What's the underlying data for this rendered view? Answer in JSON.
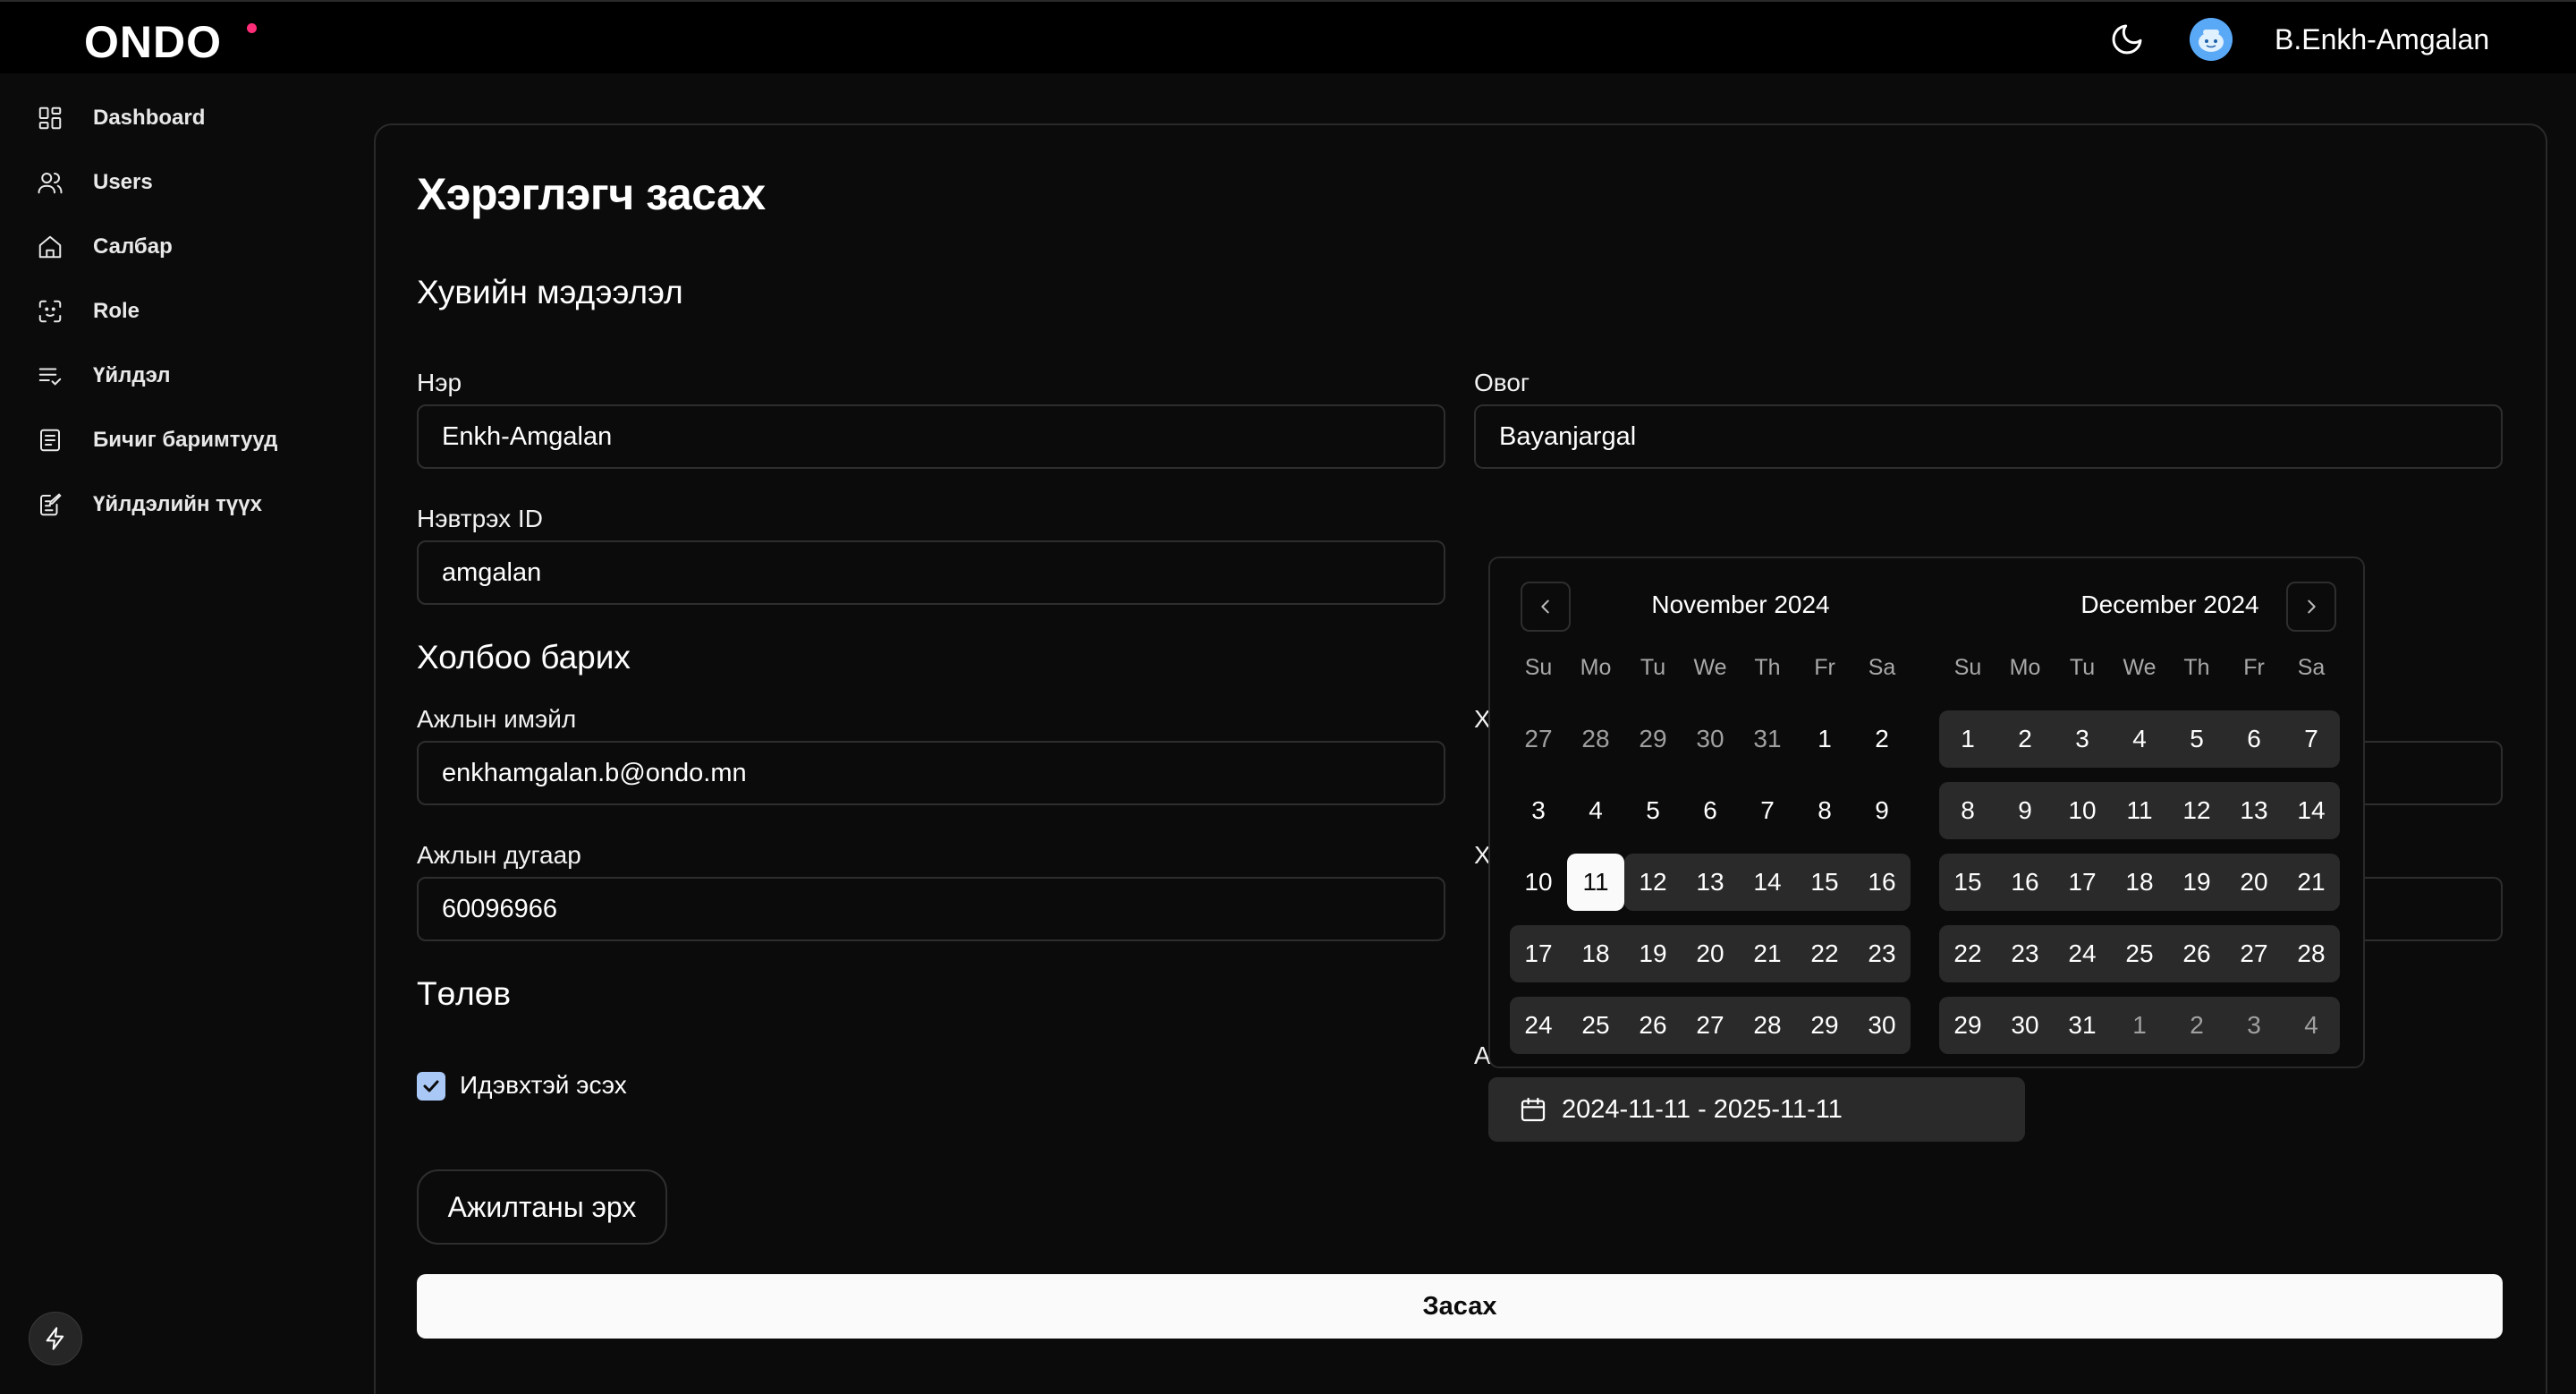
{
  "header": {
    "logo": "ONDO",
    "username": "B.Enkh-Amgalan",
    "icons": {
      "theme": "moon-icon",
      "avatar": "avatar-icon"
    },
    "accent_color": "#ff2d78"
  },
  "sidebar": {
    "items": [
      {
        "label": "Dashboard",
        "icon": "dashboard-icon"
      },
      {
        "label": "Users",
        "icon": "users-icon"
      },
      {
        "label": "Салбар",
        "icon": "home-icon"
      },
      {
        "label": "Role",
        "icon": "face-scan-icon"
      },
      {
        "label": "Үйлдэл",
        "icon": "list-check-icon"
      },
      {
        "label": "Бичиг баримтууд",
        "icon": "document-icon"
      },
      {
        "label": "Үйлдэлийн түүх",
        "icon": "history-edit-icon"
      }
    ],
    "bottom_icon": "bolt-icon"
  },
  "form": {
    "title": "Хэрэглэгч засах",
    "personal_section": "Хувийн мэдээлэл",
    "first_name_label": "Нэр",
    "first_name_value": "Enkh-Amgalan",
    "last_name_label": "Овог",
    "last_name_value": "Bayanjargal",
    "login_id_label": "Нэвтрэх ID",
    "login_id_value": "amgalan",
    "contact_section": "Холбоо барих",
    "work_email_label": "Ажлын имэйл",
    "work_email_value": "enkhamgalan.b@ondo.mn",
    "work_phone_label": "Ажлын дугаар",
    "work_phone_value": "60096966",
    "partial_label_1": "Х",
    "partial_label_2": "Х",
    "partial_label_3": "А",
    "status_section": "Төлөв",
    "active_label": "Идэвхтэй эсэх",
    "active_checked": true,
    "permissions_button": "Ажилтаны эрх",
    "submit_button": "Засах"
  },
  "date_range": {
    "value": "2024-11-11 - 2025-11-11",
    "icon": "calendar-icon"
  },
  "calendar": {
    "weekdays": [
      "Su",
      "Mo",
      "Tu",
      "We",
      "Th",
      "Fr",
      "Sa"
    ],
    "months": [
      {
        "title": "November 2024",
        "weeks": [
          [
            "27",
            "28",
            "29",
            "30",
            "31",
            "1",
            "2"
          ],
          [
            "3",
            "4",
            "5",
            "6",
            "7",
            "8",
            "9"
          ],
          [
            "10",
            "11",
            "12",
            "13",
            "14",
            "15",
            "16"
          ],
          [
            "17",
            "18",
            "19",
            "20",
            "21",
            "22",
            "23"
          ],
          [
            "24",
            "25",
            "26",
            "27",
            "28",
            "29",
            "30"
          ]
        ]
      },
      {
        "title": "December 2024",
        "weeks": [
          [
            "1",
            "2",
            "3",
            "4",
            "5",
            "6",
            "7"
          ],
          [
            "8",
            "9",
            "10",
            "11",
            "12",
            "13",
            "14"
          ],
          [
            "15",
            "16",
            "17",
            "18",
            "19",
            "20",
            "21"
          ],
          [
            "22",
            "23",
            "24",
            "25",
            "26",
            "27",
            "28"
          ],
          [
            "29",
            "30",
            "31",
            "1",
            "2",
            "3",
            "4"
          ]
        ]
      }
    ],
    "selected_date": "2024-11-11",
    "nav_icons": {
      "prev": "chevron-left-icon",
      "next": "chevron-right-icon"
    }
  }
}
